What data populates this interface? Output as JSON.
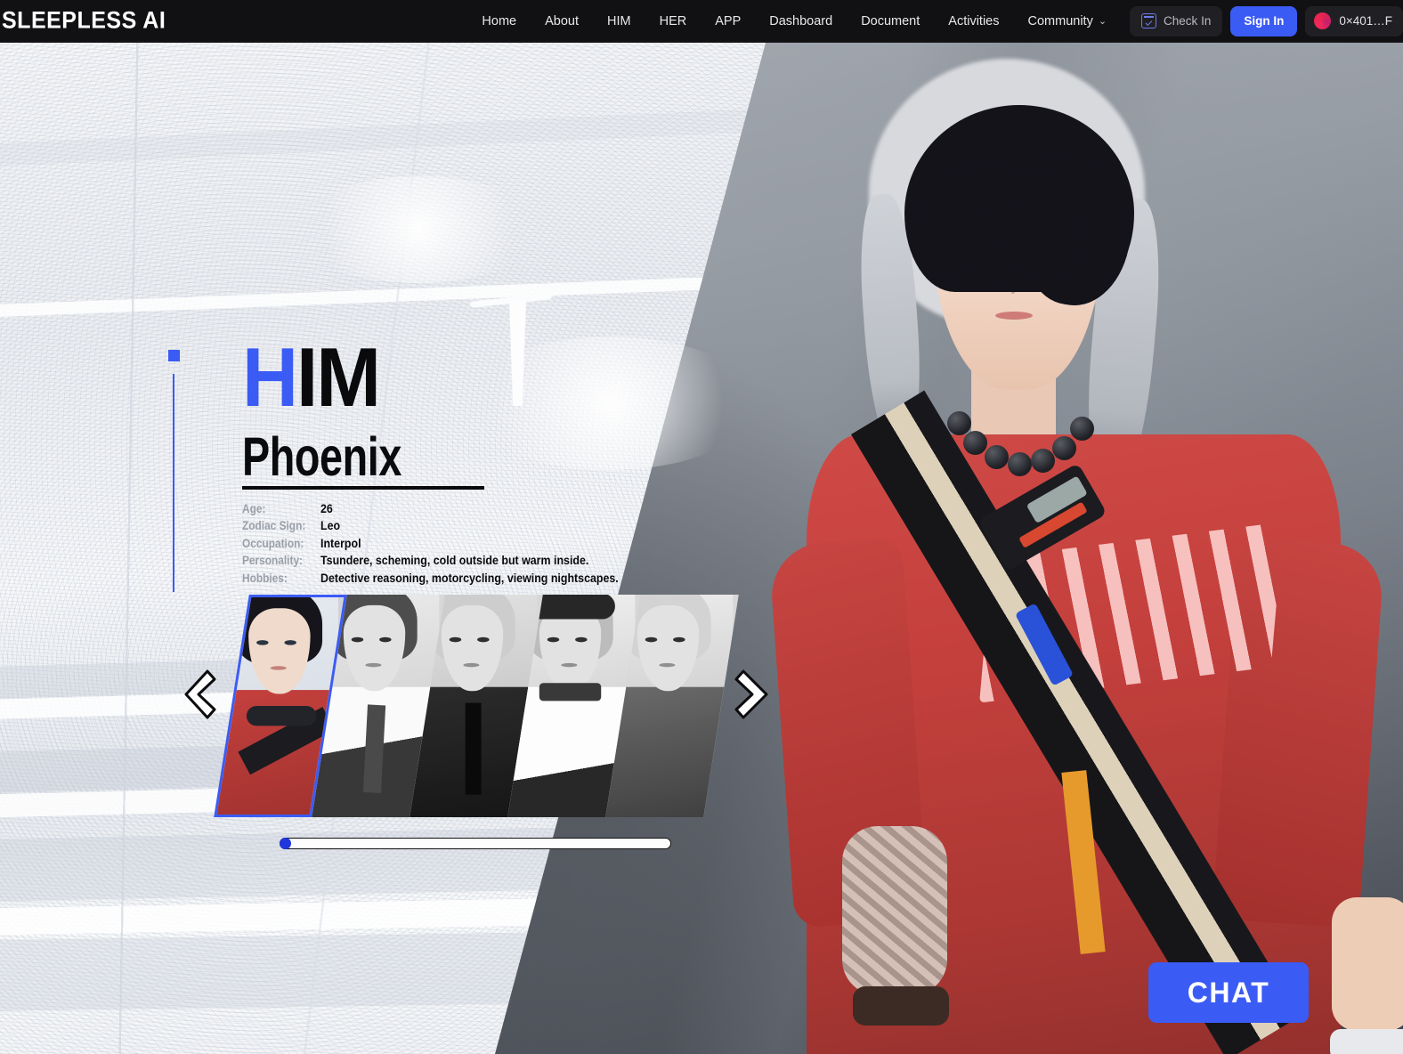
{
  "navbar": {
    "logo": "SLEEPLESS AI",
    "links": [
      {
        "label": "Home"
      },
      {
        "label": "About"
      },
      {
        "label": "HIM"
      },
      {
        "label": "HER"
      },
      {
        "label": "APP"
      },
      {
        "label": "Dashboard"
      },
      {
        "label": "Document"
      },
      {
        "label": "Activities"
      },
      {
        "label": "Community",
        "caret": "⌄"
      }
    ],
    "check_in_label": "Check In",
    "sign_in_label": "Sign In",
    "wallet_address": "0×401…F"
  },
  "hero": {
    "category_title_first": "H",
    "category_title_rest": "IM",
    "character_name": "Phoenix",
    "attributes": [
      {
        "key": "Age:",
        "value": "26"
      },
      {
        "key": "Zodiac Sign:",
        "value": "Leo"
      },
      {
        "key": "Occupation:",
        "value": "Interpol"
      },
      {
        "key": "Personality:",
        "value": "Tsundere, scheming, cold outside but warm inside."
      },
      {
        "key": "Hobbies:",
        "value": "Detective reasoning, motorcycling, viewing nightscapes."
      }
    ],
    "chat_label": "CHAT"
  },
  "carousel": {
    "prev_label": "❮",
    "next_label": "❯",
    "selected_index": 0,
    "slider_value": 0,
    "thumbnails": [
      {
        "name": "phoenix-thumb",
        "selected": true,
        "hair": "#16151c",
        "accent": "#c4403d"
      },
      {
        "name": "character-2-thumb",
        "selected": false,
        "hair": "#4f4f52",
        "accent": "#dcdcdf"
      },
      {
        "name": "character-3-thumb",
        "selected": false,
        "hair": "#c9c9cc",
        "accent": "#2e2e31"
      },
      {
        "name": "character-4-thumb",
        "selected": false,
        "hair": "#b9b9bd",
        "accent": "#f0f0f2"
      },
      {
        "name": "character-5-thumb",
        "selected": false,
        "hair": "#cfcfd2",
        "accent": "#56565a"
      }
    ]
  },
  "colors": {
    "accent_blue": "#3b5bf5",
    "nav_bg": "#111113",
    "shirt_red": "#c4403d"
  }
}
